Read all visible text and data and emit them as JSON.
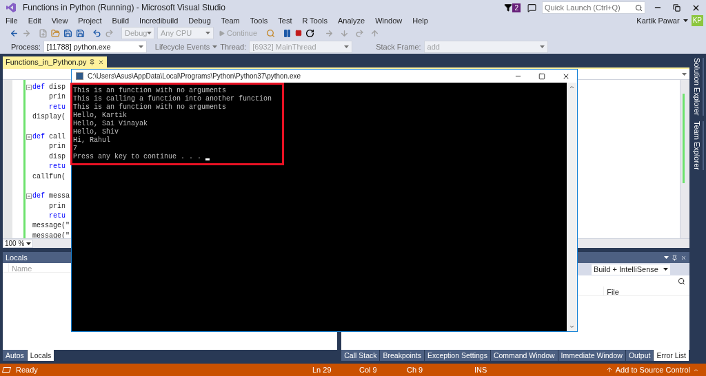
{
  "window": {
    "title": "Functions in Python (Running) - Microsoft Visual Studio",
    "notifications": "2",
    "quick_launch": {
      "placeholder": "Quick Launch (Ctrl+Q)"
    }
  },
  "menu": [
    {
      "label": "File"
    },
    {
      "label": "Edit"
    },
    {
      "label": "View"
    },
    {
      "label": "Project"
    },
    {
      "label": "Build"
    },
    {
      "label": "Incredibuild"
    },
    {
      "label": "Debug"
    },
    {
      "label": "Team"
    },
    {
      "label": "Tools"
    },
    {
      "label": "Test"
    },
    {
      "label": "R Tools"
    },
    {
      "label": "Analyze"
    },
    {
      "label": "Window"
    },
    {
      "label": "Help"
    }
  ],
  "account": {
    "name": "Kartik Pawar",
    "initials": "KP"
  },
  "toolbar": {
    "configuration": {
      "value": "Debug",
      "disabled": true
    },
    "platform": {
      "value": "Any CPU",
      "disabled": true
    },
    "continue": "Continue"
  },
  "debug_location": {
    "process_label": "Process:",
    "process": {
      "value": "[11788] python.exe",
      "disabled": false
    },
    "lifecycle": "Lifecycle Events",
    "thread_label": "Thread:",
    "thread": {
      "value": "[6932] MainThread",
      "disabled": true
    },
    "stack_label": "Stack Frame:",
    "stack": {
      "value": "add",
      "disabled": true
    }
  },
  "document_tab": {
    "label": "Functions_in_Python.py",
    "selected": true
  },
  "editor": {
    "lines": [
      {
        "kind": "def",
        "keyword": "def",
        "text": "disp"
      },
      {
        "kind": "body",
        "text": "prin"
      },
      {
        "kind": "body-keyword",
        "text": "retu"
      },
      {
        "kind": "call",
        "text": "display("
      },
      {
        "kind": "blank"
      },
      {
        "kind": "def",
        "keyword": "def",
        "text": "call"
      },
      {
        "kind": "body",
        "text": "prin"
      },
      {
        "kind": "body",
        "text": "disp"
      },
      {
        "kind": "body-keyword",
        "text": "retu"
      },
      {
        "kind": "call",
        "text": "callfun("
      },
      {
        "kind": "blank"
      },
      {
        "kind": "def",
        "keyword": "def",
        "text": "messa"
      },
      {
        "kind": "body",
        "text": "prin"
      },
      {
        "kind": "body-keyword",
        "text": "retu"
      },
      {
        "kind": "call",
        "text": "message(\""
      },
      {
        "kind": "call",
        "text": "message(\""
      }
    ],
    "zoom": "100 %"
  },
  "side_tabs": [
    {
      "label": "Solution Explorer"
    },
    {
      "label": "Team Explorer"
    }
  ],
  "console": {
    "title": "C:\\Users\\Asus\\AppData\\Local\\Programs\\Python\\Python37\\python.exe",
    "lines": [
      "This is an function with no arguments",
      "This is calling a function into another function",
      "This is an function with no arguments",
      "Hello, Kartik",
      "Hello, Sai Vinayak",
      "Hello, Shiv",
      "Hi, Rahul",
      "7",
      "Press any key to continue . . ."
    ],
    "highlighted": true
  },
  "locals_panel": {
    "title": "Locals",
    "columns": [
      "Name"
    ],
    "tabs": [
      {
        "label": "Autos",
        "selected": false
      },
      {
        "label": "Locals",
        "selected": true
      }
    ]
  },
  "error_panel": {
    "filter": "Build + IntelliSense",
    "columns": [
      "File"
    ],
    "tabs": [
      {
        "label": "Call Stack",
        "selected": false
      },
      {
        "label": "Breakpoints",
        "selected": false
      },
      {
        "label": "Exception Settings",
        "selected": false
      },
      {
        "label": "Command Window",
        "selected": false
      },
      {
        "label": "Immediate Window",
        "selected": false
      },
      {
        "label": "Output",
        "selected": false
      },
      {
        "label": "Error List",
        "selected": true
      }
    ]
  },
  "status_bar": {
    "state": "Ready",
    "line": "Ln 29",
    "column": "Col 9",
    "char": "Ch 9",
    "mode": "INS",
    "source_control": "Add to Source Control"
  }
}
